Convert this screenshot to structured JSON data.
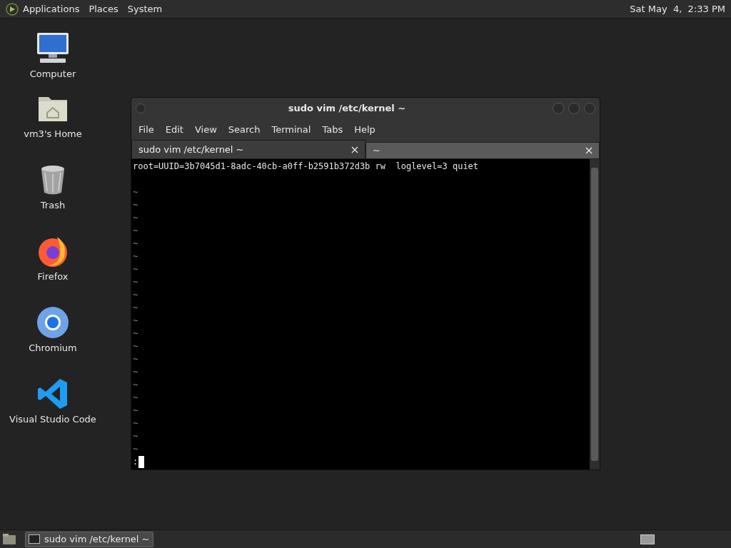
{
  "top_panel": {
    "menus": [
      "Applications",
      "Places",
      "System"
    ],
    "clock": "Sat May  4,  2:33 PM"
  },
  "desktop_icons": [
    {
      "label": "Computer",
      "kind": "computer"
    },
    {
      "label": "vm3's Home",
      "kind": "home"
    },
    {
      "label": "Trash",
      "kind": "trash"
    },
    {
      "label": "Firefox",
      "kind": "firefox"
    },
    {
      "label": "Chromium",
      "kind": "chromium"
    },
    {
      "label": "Visual Studio Code",
      "kind": "vscode"
    }
  ],
  "terminal": {
    "title": "sudo vim /etc/kernel ~",
    "menu": [
      "File",
      "Edit",
      "View",
      "Search",
      "Terminal",
      "Tabs",
      "Help"
    ],
    "tabs": [
      {
        "label": "sudo vim /etc/kernel ~",
        "selected": true
      },
      {
        "label": "~",
        "selected": false
      }
    ],
    "lines": [
      "root=UUID=3b7045d1-8adc-40cb-a0ff-b2591b372d3b rw  loglevel=3 quiet"
    ],
    "tildes": [
      "~",
      "~",
      "~",
      "~",
      "~",
      "~",
      "~",
      "~",
      "~",
      "~",
      "~",
      "~",
      "~",
      "~",
      "~",
      "~",
      "~",
      "~",
      "~",
      "~",
      "~"
    ],
    "command_line": ":"
  },
  "taskbar": {
    "tasks": [
      {
        "label": "sudo vim /etc/kernel ~",
        "selected": true
      }
    ]
  }
}
